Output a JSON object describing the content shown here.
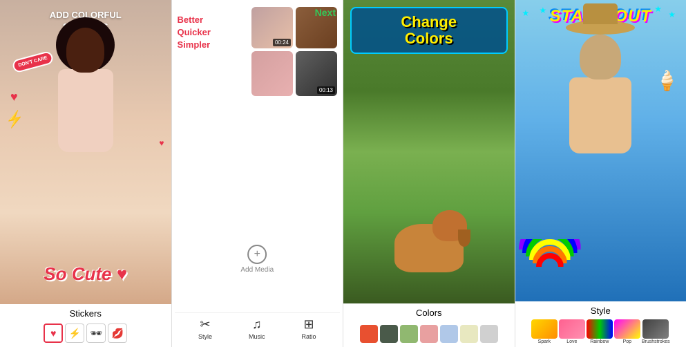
{
  "panels": [
    {
      "id": "panel1",
      "title": "ADD COLORFUL\nSTICKERS",
      "label": "Stickers",
      "sticker_socute": "So Cute ♥",
      "swatches": [
        {
          "type": "heart",
          "symbol": "♥",
          "selected": true
        },
        {
          "type": "lightning",
          "symbol": "⚡"
        },
        {
          "type": "glasses",
          "symbol": "🕶"
        },
        {
          "type": "lips",
          "symbol": "👄"
        }
      ]
    },
    {
      "id": "panel2",
      "title": "Better\nQuicker\nSimpler",
      "label": "Add Media",
      "next_label": "Next",
      "toolbar": [
        {
          "label": "Style",
          "icon": "✂"
        },
        {
          "label": "Music",
          "icon": "♫"
        },
        {
          "label": "Ratio",
          "icon": "⊞"
        }
      ],
      "durations": [
        "00:24",
        "00:13"
      ]
    },
    {
      "id": "panel3",
      "title": "Change\nColors",
      "label": "Colors",
      "color_swatches": [
        "#e85030",
        "#4a5a4a",
        "#90b870",
        "#e8a0a0",
        "#b0c8e8",
        "#e8e8c0",
        "#d0d0d0"
      ]
    },
    {
      "id": "panel4",
      "title": "STAND OUT",
      "label": "Style",
      "style_swatches": [
        {
          "label": "Spark",
          "colors": [
            "#ffd700",
            "#ff8c00"
          ]
        },
        {
          "label": "Love",
          "colors": [
            "#ff6090",
            "#ff90b0"
          ]
        },
        {
          "label": "Rainbow",
          "colors": [
            "#ff0000",
            "#00cc00",
            "#0000ff"
          ]
        },
        {
          "label": "Pop",
          "colors": [
            "#ff00ff",
            "#ffff00"
          ]
        },
        {
          "label": "Brushstrokes",
          "colors": [
            "#404040",
            "#808080"
          ]
        }
      ]
    }
  ]
}
